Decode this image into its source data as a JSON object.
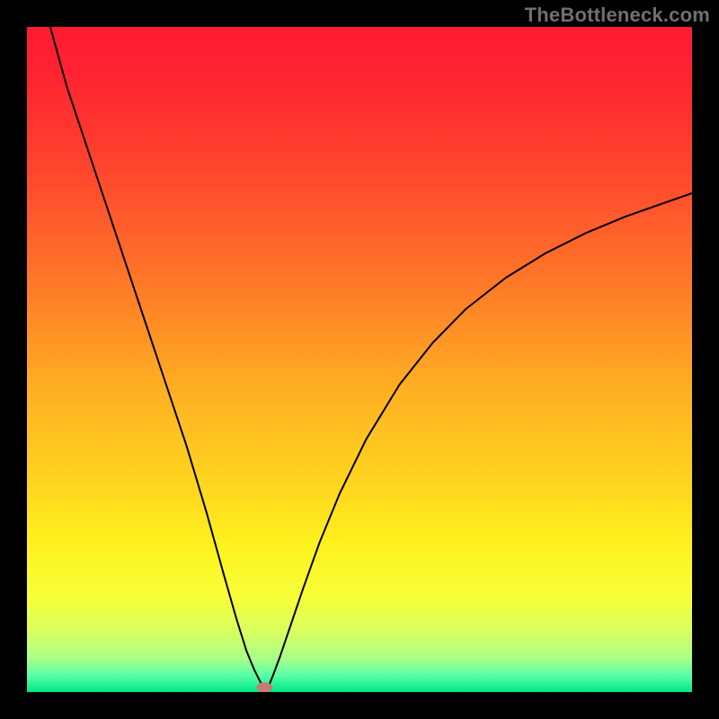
{
  "watermark": "TheBottleneck.com",
  "chart_data": {
    "type": "line",
    "title": "",
    "xlabel": "",
    "ylabel": "",
    "xlim": [
      0,
      100
    ],
    "ylim": [
      0,
      100
    ],
    "background_gradient": {
      "stops": [
        {
          "offset": 0.0,
          "color": "#ff1a33"
        },
        {
          "offset": 0.08,
          "color": "#ff2531"
        },
        {
          "offset": 0.18,
          "color": "#ff3d2e"
        },
        {
          "offset": 0.3,
          "color": "#ff5e2b"
        },
        {
          "offset": 0.42,
          "color": "#ff8426"
        },
        {
          "offset": 0.55,
          "color": "#ffb122"
        },
        {
          "offset": 0.68,
          "color": "#ffd31f"
        },
        {
          "offset": 0.78,
          "color": "#fff21e"
        },
        {
          "offset": 0.86,
          "color": "#f7ff3a"
        },
        {
          "offset": 0.91,
          "color": "#d8ff60"
        },
        {
          "offset": 0.95,
          "color": "#a8ff88"
        },
        {
          "offset": 0.975,
          "color": "#58ffa8"
        },
        {
          "offset": 1.0,
          "color": "#00e884"
        }
      ]
    },
    "series": [
      {
        "name": "left-branch",
        "stroke": "#000000",
        "stroke_width": 2.0,
        "x": [
          3.5,
          6,
          9,
          12,
          15,
          18,
          21,
          24,
          27,
          29.5,
          31.5,
          33,
          34.2,
          35,
          35.6,
          35.9
        ],
        "y": [
          100,
          91,
          82,
          73,
          64,
          55,
          46,
          37,
          27,
          18,
          11,
          6.2,
          3.3,
          1.7,
          0.6,
          0.05
        ]
      },
      {
        "name": "right-branch",
        "stroke": "#000000",
        "stroke_width": 2.0,
        "x": [
          35.9,
          36.3,
          37,
          38,
          39.5,
          41.5,
          44,
          47,
          51,
          56,
          61,
          66,
          72,
          78,
          84,
          90,
          96,
          100
        ],
        "y": [
          0.05,
          0.8,
          2.5,
          5.2,
          9.6,
          15.5,
          22.5,
          29.8,
          38.0,
          46.2,
          52.5,
          57.6,
          62.3,
          66.0,
          69.0,
          71.5,
          73.6,
          75.0
        ]
      }
    ],
    "marker": {
      "name": "valley-marker",
      "x": 35.7,
      "y": 0.7,
      "rx": 1.2,
      "ry": 0.75,
      "fill": "#c97a78"
    }
  }
}
